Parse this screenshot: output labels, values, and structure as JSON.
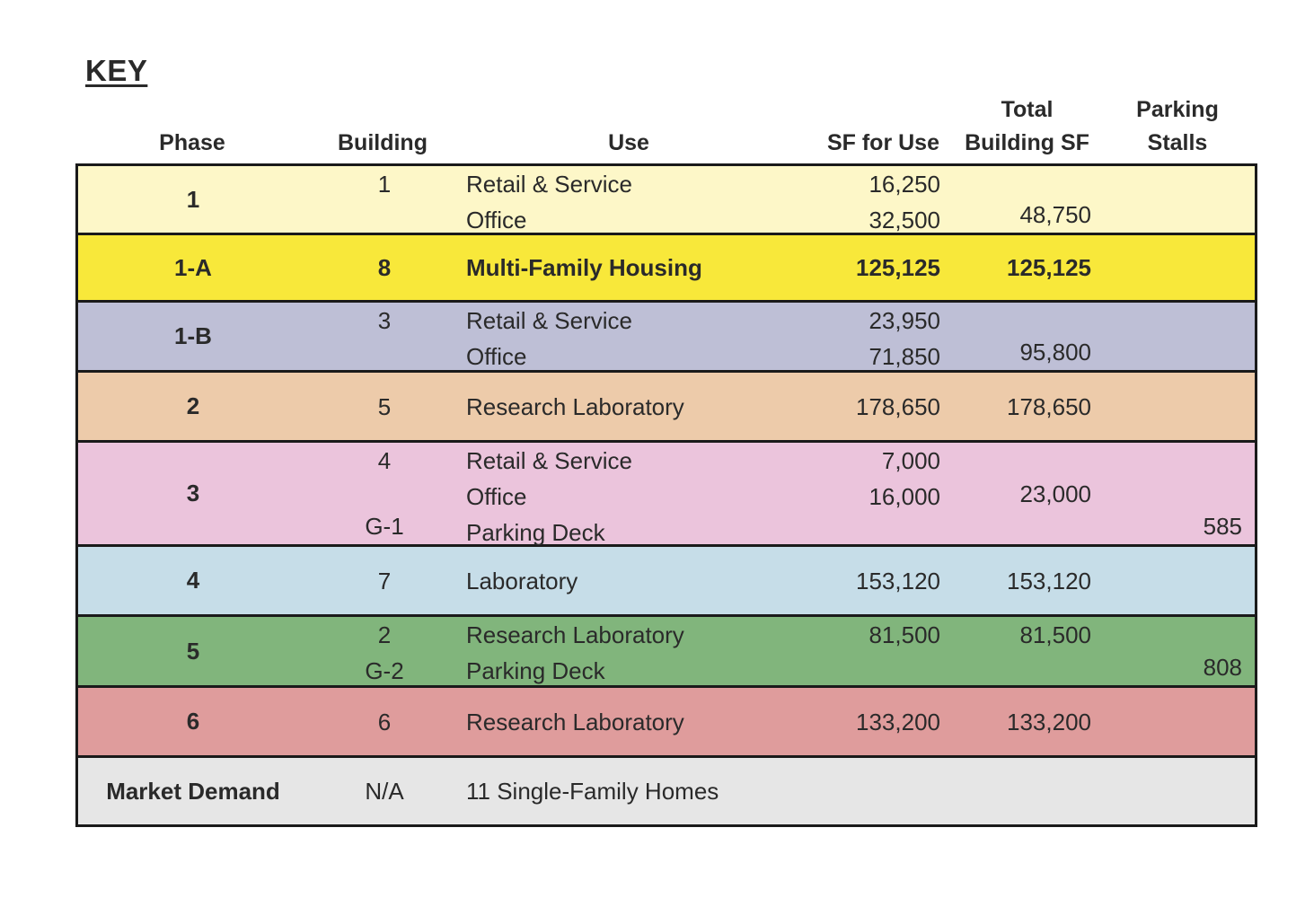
{
  "key_title": "KEY",
  "headers": {
    "phase": "Phase",
    "building": "Building",
    "use": "Use",
    "sf_for_use": "SF for Use",
    "total_building_sf_line1": "Total",
    "total_building_sf_line2": "Building SF",
    "parking_stalls_line1": "Parking",
    "parking_stalls_line2": "Stalls"
  },
  "colors": {
    "phase_1": "#fdf7c8",
    "phase_1a": "#f8e83a",
    "phase_1b": "#bebfd6",
    "phase_2": "#edcbaa",
    "phase_3": "#ebc4dc",
    "phase_4": "#c6dde8",
    "phase_5": "#81b57c",
    "phase_6": "#df9c9c",
    "market_demand": "#e6e6e6",
    "border": "#1a1a1a"
  },
  "rows": [
    {
      "phase": "1",
      "lines": [
        {
          "building": "1",
          "use": "Retail & Service",
          "sf_for_use": "16,250",
          "total": "",
          "parking": ""
        },
        {
          "building": "",
          "use": "Office",
          "sf_for_use": "32,500",
          "total": "48,750",
          "parking": ""
        }
      ]
    },
    {
      "phase": "1-A",
      "lines": [
        {
          "building": "8",
          "use": "Multi-Family Housing",
          "sf_for_use": "125,125",
          "total": "125,125",
          "parking": ""
        }
      ]
    },
    {
      "phase": "1-B",
      "lines": [
        {
          "building": "3",
          "use": "Retail & Service",
          "sf_for_use": "23,950",
          "total": "",
          "parking": ""
        },
        {
          "building": "",
          "use": "Office",
          "sf_for_use": "71,850",
          "total": "95,800",
          "parking": ""
        }
      ]
    },
    {
      "phase": "2",
      "lines": [
        {
          "building": "5",
          "use": "Research Laboratory",
          "sf_for_use": "178,650",
          "total": "178,650",
          "parking": ""
        }
      ]
    },
    {
      "phase": "3",
      "lines": [
        {
          "building": "4",
          "use": "Retail & Service",
          "sf_for_use": "7,000",
          "total": "",
          "parking": ""
        },
        {
          "building": "",
          "use": "Office",
          "sf_for_use": "16,000",
          "total": "23,000",
          "parking": ""
        },
        {
          "building": "G-1",
          "use": "Parking Deck",
          "sf_for_use": "",
          "total": "",
          "parking": "585"
        }
      ]
    },
    {
      "phase": "4",
      "lines": [
        {
          "building": "7",
          "use": "Laboratory",
          "sf_for_use": "153,120",
          "total": "153,120",
          "parking": ""
        }
      ]
    },
    {
      "phase": "5",
      "lines": [
        {
          "building": "2",
          "use": "Research Laboratory",
          "sf_for_use": "81,500",
          "total": "81,500",
          "parking": ""
        },
        {
          "building": "G-2",
          "use": "Parking Deck",
          "sf_for_use": "",
          "total": "",
          "parking": "808"
        }
      ]
    },
    {
      "phase": "6",
      "lines": [
        {
          "building": "6",
          "use": "Research Laboratory",
          "sf_for_use": "133,200",
          "total": "133,200",
          "parking": ""
        }
      ]
    },
    {
      "phase": "Market Demand",
      "lines": [
        {
          "building": "N/A",
          "use": "11 Single-Family Homes",
          "sf_for_use": "",
          "total": "",
          "parking": ""
        }
      ]
    }
  ]
}
